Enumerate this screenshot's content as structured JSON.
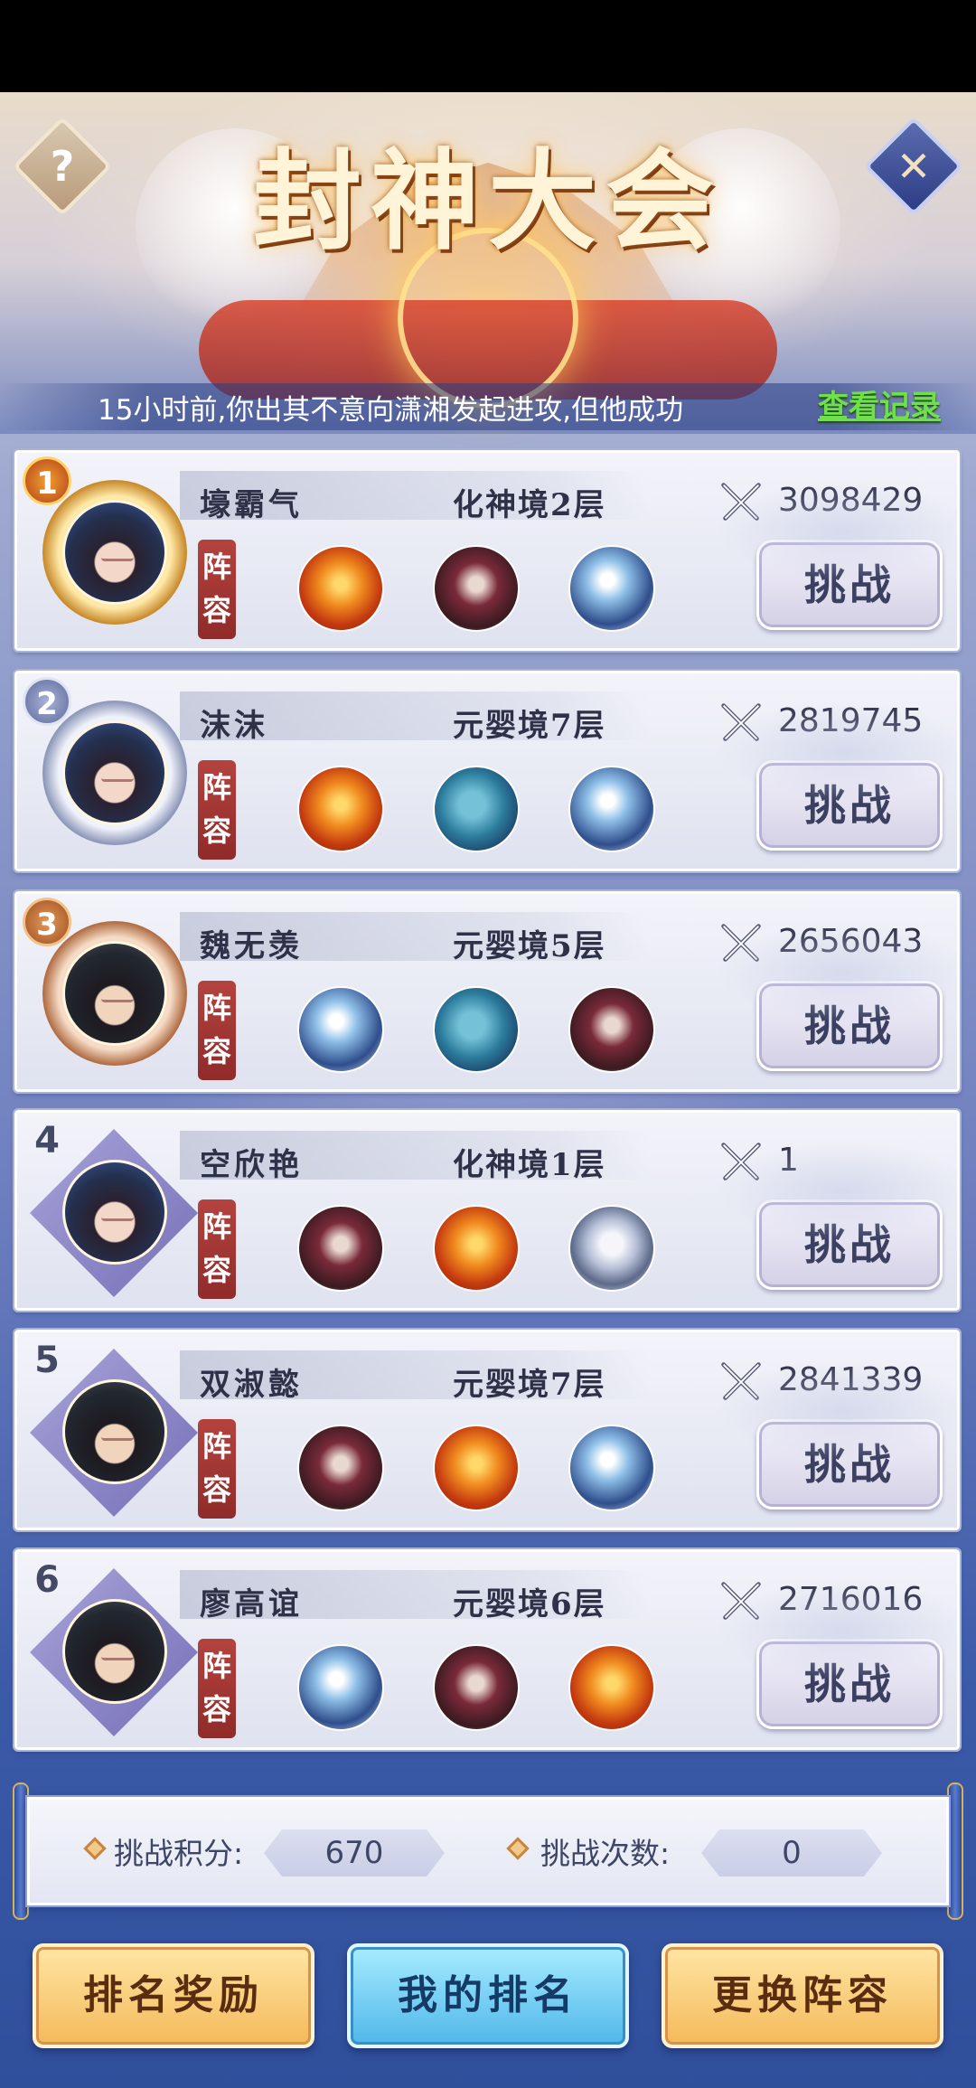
{
  "header": {
    "title": "封神大会",
    "help_icon_glyph": "?",
    "close_icon_glyph": "✕"
  },
  "notice": {
    "text": "15小时前,你出其不意向潇湘发起进攻,但他成功",
    "record_link": "查看记录"
  },
  "lineup_label_top": "阵",
  "lineup_label_bottom": "容",
  "challenge_label": "挑战",
  "entries": [
    {
      "rank": "1",
      "name": "壕霸气",
      "realm": "化神境2层",
      "power": "3098429",
      "avatar": "female",
      "frame": "gold",
      "pets": [
        "bird",
        "beast",
        "dragon"
      ]
    },
    {
      "rank": "2",
      "name": "沫沫",
      "realm": "元婴境7层",
      "power": "2819745",
      "avatar": "female",
      "frame": "silver",
      "pets": [
        "bird",
        "whale",
        "dragon"
      ]
    },
    {
      "rank": "3",
      "name": "魏无羡",
      "realm": "元婴境5层",
      "power": "2656043",
      "avatar": "male",
      "frame": "bronze",
      "pets": [
        "dragon",
        "whale",
        "beast"
      ]
    },
    {
      "rank": "4",
      "name": "空欣艳",
      "realm": "化神境1层",
      "power": "1",
      "avatar": "female",
      "frame": "diamond",
      "pets": [
        "beast",
        "bird",
        "tiger"
      ]
    },
    {
      "rank": "5",
      "name": "双淑懿",
      "realm": "元婴境7层",
      "power": "2841339",
      "avatar": "male",
      "frame": "diamond",
      "pets": [
        "beast",
        "bird",
        "dragon"
      ]
    },
    {
      "rank": "6",
      "name": "廖高谊",
      "realm": "元婴境6层",
      "power": "2716016",
      "avatar": "male",
      "frame": "diamond",
      "pets": [
        "dragon",
        "beast",
        "bird"
      ]
    }
  ],
  "stats": {
    "points_label": "挑战积分:",
    "points_value": "670",
    "attempts_label": "挑战次数:",
    "attempts_value": "0"
  },
  "buttons": {
    "rank_reward": "排名奖励",
    "my_rank": "我的排名",
    "change_lineup": "更换阵容"
  }
}
